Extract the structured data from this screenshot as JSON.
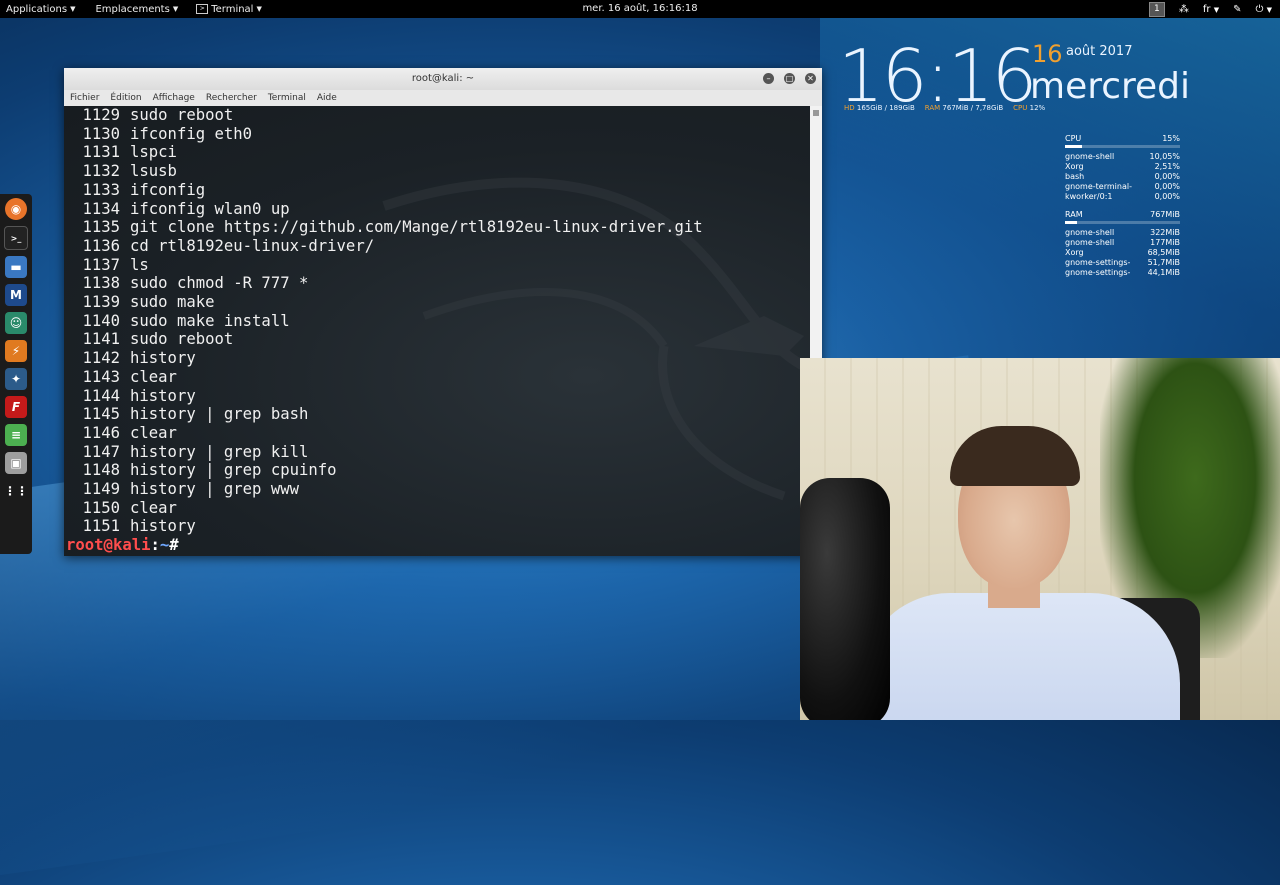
{
  "topbar": {
    "applications": "Applications",
    "places": "Emplacements",
    "app_terminal": "Terminal",
    "clock": "mer. 16 août, 16:16:18",
    "workspace": "1",
    "lang": "fr"
  },
  "dock": {
    "items": [
      "firefox-icon",
      "terminal-icon",
      "files-icon",
      "metasploit-icon",
      "armitage-icon",
      "burpsuite-icon",
      "maltego-icon",
      "faraday-icon",
      "leafpad-icon",
      "appstore-icon",
      "show-apps-icon"
    ]
  },
  "terminal": {
    "title": "root@kali: ~",
    "menu": [
      "Fichier",
      "Édition",
      "Affichage",
      "Rechercher",
      "Terminal",
      "Aide"
    ],
    "history": [
      {
        "n": "1129",
        "cmd": "sudo reboot"
      },
      {
        "n": "1130",
        "cmd": "ifconfig eth0"
      },
      {
        "n": "1131",
        "cmd": "lspci"
      },
      {
        "n": "1132",
        "cmd": "lsusb"
      },
      {
        "n": "1133",
        "cmd": "ifconfig"
      },
      {
        "n": "1134",
        "cmd": "ifconfig wlan0 up"
      },
      {
        "n": "1135",
        "cmd": "git clone https://github.com/Mange/rtl8192eu-linux-driver.git"
      },
      {
        "n": "1136",
        "cmd": "cd rtl8192eu-linux-driver/"
      },
      {
        "n": "1137",
        "cmd": "ls"
      },
      {
        "n": "1138",
        "cmd": "sudo chmod -R 777 *"
      },
      {
        "n": "1139",
        "cmd": "sudo make"
      },
      {
        "n": "1140",
        "cmd": "sudo make install"
      },
      {
        "n": "1141",
        "cmd": "sudo reboot"
      },
      {
        "n": "1142",
        "cmd": "history"
      },
      {
        "n": "1143",
        "cmd": "clear"
      },
      {
        "n": "1144",
        "cmd": "history"
      },
      {
        "n": "1145",
        "cmd": "history | grep bash"
      },
      {
        "n": "1146",
        "cmd": "clear"
      },
      {
        "n": "1147",
        "cmd": "history | grep kill"
      },
      {
        "n": "1148",
        "cmd": "history | grep cpuinfo"
      },
      {
        "n": "1149",
        "cmd": "history | grep www"
      },
      {
        "n": "1150",
        "cmd": "clear"
      },
      {
        "n": "1151",
        "cmd": "history"
      }
    ],
    "prompt_user": "root@kali",
    "prompt_sep": ":",
    "prompt_path": "~",
    "prompt_sym": "#"
  },
  "widget": {
    "time": "16:16",
    "day_num": "16",
    "month_year": "août 2017",
    "weekday": "mercredi",
    "hd_label": "HD",
    "hd_value": "165GiB / 189GiB",
    "ram_label": "RAM",
    "ram_value": "767MiB / 7,78GiB",
    "cpu_label": "CPU",
    "cpu_value": "12%"
  },
  "sysmon": {
    "cpu_label": "CPU",
    "cpu_value": "15%",
    "cpu_fraction": 0.15,
    "cpu_procs": [
      {
        "name": "gnome-shell",
        "val": "10,05%"
      },
      {
        "name": "Xorg",
        "val": "2,51%"
      },
      {
        "name": "bash",
        "val": "0,00%"
      },
      {
        "name": "gnome-terminal-",
        "val": "0,00%"
      },
      {
        "name": "kworker/0:1",
        "val": "0,00%"
      }
    ],
    "ram_label": "RAM",
    "ram_value": "767MiB",
    "ram_fraction": 0.1,
    "ram_procs": [
      {
        "name": "gnome-shell",
        "val": "322MiB"
      },
      {
        "name": "gnome-shell",
        "val": "177MiB"
      },
      {
        "name": "Xorg",
        "val": "68,5MiB"
      },
      {
        "name": "gnome-settings-",
        "val": "51,7MiB"
      },
      {
        "name": "gnome-settings-",
        "val": "44,1MiB"
      }
    ]
  }
}
